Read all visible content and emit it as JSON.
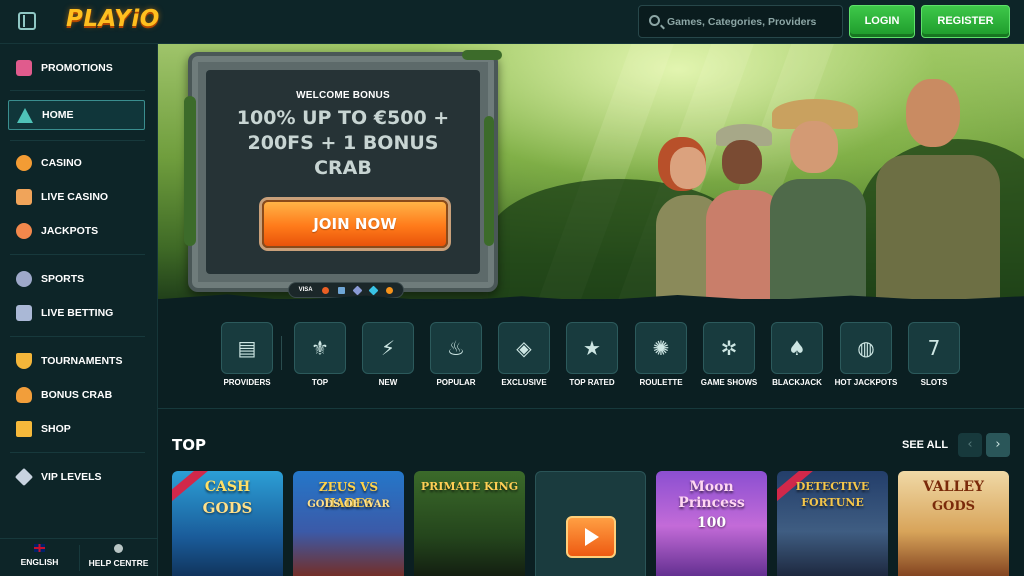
{
  "header": {
    "logo": "PLAYiO",
    "search_placeholder": "Games, Categories, Providers",
    "login_label": "LOGIN",
    "register_label": "REGISTER",
    "accent_green": "#2fb33d"
  },
  "sidebar": {
    "items": [
      {
        "label": "PROMOTIONS",
        "icon": "gift-icon"
      },
      {
        "label": "HOME",
        "icon": "tent-icon",
        "active": true
      },
      {
        "label": "CASINO",
        "icon": "chip-icon"
      },
      {
        "label": "LIVE CASINO",
        "icon": "cards-icon"
      },
      {
        "label": "JACKPOTS",
        "icon": "clover-icon"
      },
      {
        "label": "SPORTS",
        "icon": "football-icon"
      },
      {
        "label": "LIVE BETTING",
        "icon": "live-icon"
      },
      {
        "label": "TOURNAMENTS",
        "icon": "trophy-icon"
      },
      {
        "label": "BONUS CRAB",
        "icon": "crab-icon"
      },
      {
        "label": "SHOP",
        "icon": "bag-icon"
      },
      {
        "label": "VIP LEVELS",
        "icon": "diamond-icon"
      }
    ],
    "footer": {
      "language": "ENGLISH",
      "help": "HELP CENTRE"
    }
  },
  "hero": {
    "kicker": "WELCOME BONUS",
    "headline_line1": "100% UP TO €500 +",
    "headline_line2": "200FS + 1 BONUS",
    "headline_line3": "CRAB",
    "cta": "JOIN NOW",
    "payments": {
      "visa": "VISA"
    }
  },
  "categories": [
    {
      "label": "PROVIDERS",
      "icon": "book-icon",
      "glyph": "▤"
    },
    {
      "label": "TOP",
      "icon": "fleur-icon",
      "glyph": "⚜"
    },
    {
      "label": "NEW",
      "icon": "lightning-icon",
      "glyph": "⚡"
    },
    {
      "label": "POPULAR",
      "icon": "fire-icon",
      "glyph": "♨"
    },
    {
      "label": "EXCLUSIVE",
      "icon": "gem-icon",
      "glyph": "◈"
    },
    {
      "label": "TOP RATED",
      "icon": "star-icon",
      "glyph": "★"
    },
    {
      "label": "ROULETTE",
      "icon": "roulette-icon",
      "glyph": "✺"
    },
    {
      "label": "GAME SHOWS",
      "icon": "wheel-icon",
      "glyph": "✲"
    },
    {
      "label": "BLACKJACK",
      "icon": "spade-icon",
      "glyph": "♠"
    },
    {
      "label": "HOT JACKPOTS",
      "icon": "hot-jackpot-icon",
      "glyph": "◍"
    },
    {
      "label": "SLOTS",
      "icon": "slot-machine-icon",
      "glyph": "7"
    }
  ],
  "top_section": {
    "title": "TOP",
    "see_all": "SEE ALL",
    "prev": "‹",
    "next": "›",
    "games": [
      {
        "title": "CASH",
        "sub": "GODS"
      },
      {
        "title": "ZEUS VS HADES",
        "sub": "GODS OF WAR"
      },
      {
        "title": "PRIMATE KING",
        "sub": ""
      },
      {
        "title": "",
        "sub": ""
      },
      {
        "title": "Moon Princess",
        "sub": "100"
      },
      {
        "title": "DETECTIVE FORTUNE",
        "sub": ""
      },
      {
        "title": "VALLEY",
        "sub": "GODS"
      }
    ]
  }
}
